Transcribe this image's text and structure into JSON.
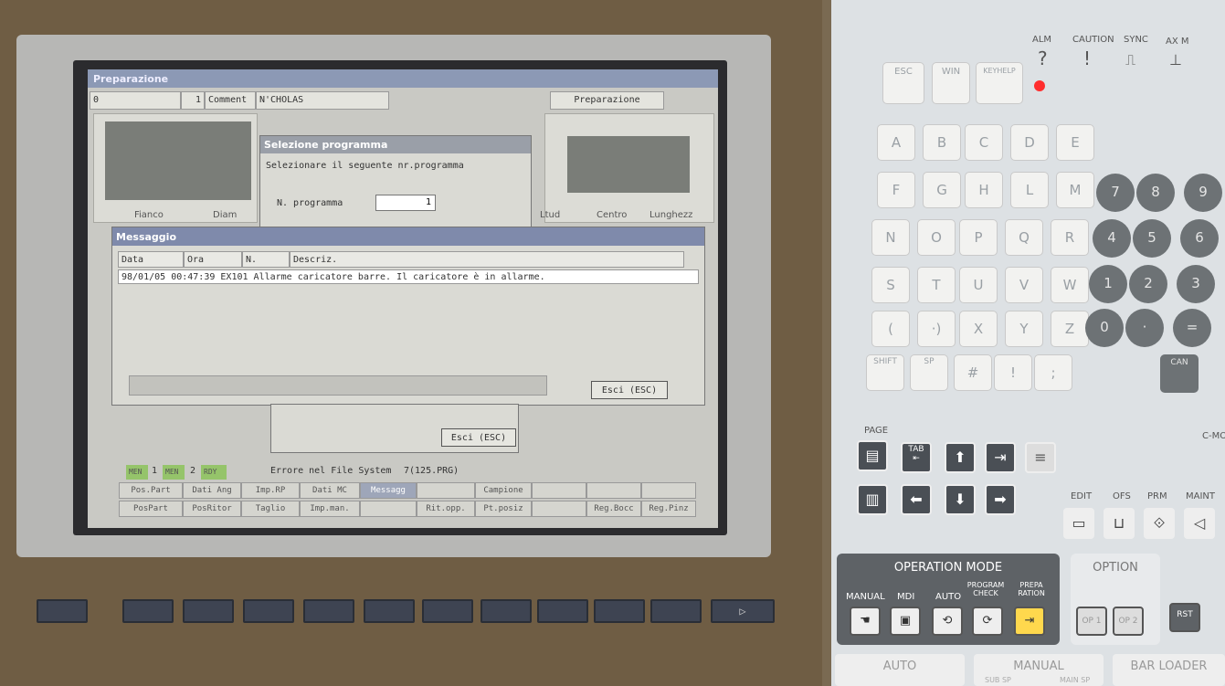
{
  "window_title": "Preparazione",
  "header": {
    "field0": "0",
    "field1": "1",
    "comment_label": "Comment",
    "comment_value": "N'CHOLAS",
    "section": "Preparazione"
  },
  "sub_labels": {
    "left1": "Fianco",
    "left2": "Diam",
    "right1": "Ltud",
    "right2": "Centro",
    "right3": "Lunghezz"
  },
  "select_dialog": {
    "title": "Selezione programma",
    "prompt": "Selezionare il seguente nr.programma",
    "field_label": "N. programma",
    "field_value": "1",
    "exit": "Esci (ESC)"
  },
  "message_dialog": {
    "title": "Messaggio",
    "columns": [
      "Data",
      "Ora",
      "N.",
      "Descriz."
    ],
    "rows": [
      {
        "date": "98/01/05",
        "time": "00:47:39",
        "code": "EX101",
        "desc": "Allarme caricatore barre. Il caricatore è in allarme."
      }
    ],
    "exit": "Esci (ESC)"
  },
  "status": {
    "badges": [
      "MEN",
      "1",
      "MEN",
      "2",
      "RDY"
    ],
    "message": "Errore nel File System",
    "detail": "7(125.PRG)"
  },
  "fkeys_top": [
    "Pos.Part",
    "Dati Ang",
    "Imp.RP",
    "Dati MC",
    "Messagg",
    "",
    "Campione",
    "",
    "",
    ""
  ],
  "fkeys_bottom": [
    "PosPart",
    "PosRitor",
    "Taglio",
    "Imp.man.",
    "",
    "Rit.opp.",
    "Pt.posiz",
    "",
    "Reg.Bocc",
    "Reg.Pinz"
  ],
  "panel": {
    "top_keys": [
      "ESC",
      "WIN",
      "KEYHELP"
    ],
    "indicators": [
      "ALM",
      "CAUTION",
      "SYNC",
      "AX M"
    ],
    "letters": [
      [
        "A",
        "B",
        "C",
        "D",
        "E"
      ],
      [
        "F",
        "G",
        "H",
        "L",
        "M"
      ],
      [
        "N",
        "O",
        "P",
        "Q",
        "R"
      ],
      [
        "S",
        "T",
        "U",
        "V",
        "W"
      ],
      [
        "(",
        "·)",
        "X",
        "Y",
        "Z"
      ]
    ],
    "numbers": [
      [
        "7",
        "8",
        "9"
      ],
      [
        "4",
        "5",
        "6"
      ],
      [
        "1",
        "2",
        "3"
      ],
      [
        "0",
        "·",
        "="
      ]
    ],
    "shift": "SHIFT",
    "sp": "SP",
    "hash": "#",
    "excl": "!",
    "semi": ";",
    "can": "CAN",
    "page": "PAGE",
    "tab": "TAB",
    "edit_labels": [
      "EDIT",
      "OFS",
      "PRM",
      "MAINT"
    ],
    "cm": "C-MO",
    "opmode_title": "OPERATION MODE",
    "opmode_labels": [
      "MANUAL",
      "MDI",
      "AUTO",
      "PROGRAM CHECK",
      "PREPA RATION"
    ],
    "option_title": "OPTION",
    "option_keys": [
      "OP 1",
      "OP 2"
    ],
    "rst": "RST",
    "bottom_labels": [
      "AUTO",
      "MANUAL",
      "BAR LOADER"
    ],
    "bottom_sub": [
      "SUB SP",
      "MAIN SP"
    ]
  },
  "colors": {
    "title_bar": "#7f8aab",
    "status_green": "#95c46a",
    "alarm_led": "#ff2d2d",
    "opmode_active": "#ffd84d"
  }
}
